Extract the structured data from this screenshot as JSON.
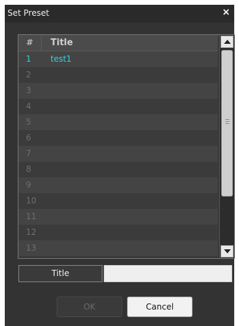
{
  "window": {
    "title": "Set Preset",
    "close_glyph": "×"
  },
  "table": {
    "headers": {
      "number": "#",
      "title": "Title"
    },
    "rows": [
      {
        "num": "1",
        "title": "test1"
      },
      {
        "num": "2",
        "title": ""
      },
      {
        "num": "3",
        "title": ""
      },
      {
        "num": "4",
        "title": ""
      },
      {
        "num": "5",
        "title": ""
      },
      {
        "num": "6",
        "title": ""
      },
      {
        "num": "7",
        "title": ""
      },
      {
        "num": "8",
        "title": ""
      },
      {
        "num": "9",
        "title": ""
      },
      {
        "num": "10",
        "title": ""
      },
      {
        "num": "11",
        "title": ""
      },
      {
        "num": "12",
        "title": ""
      },
      {
        "num": "13",
        "title": ""
      }
    ],
    "active_color": "#2fd6dc"
  },
  "form": {
    "title_label": "Title",
    "title_value": ""
  },
  "buttons": {
    "ok": "OK",
    "cancel": "Cancel"
  },
  "icons": {
    "up": "scroll-up-arrow-icon",
    "down": "scroll-down-arrow-icon",
    "close": "close-icon"
  }
}
